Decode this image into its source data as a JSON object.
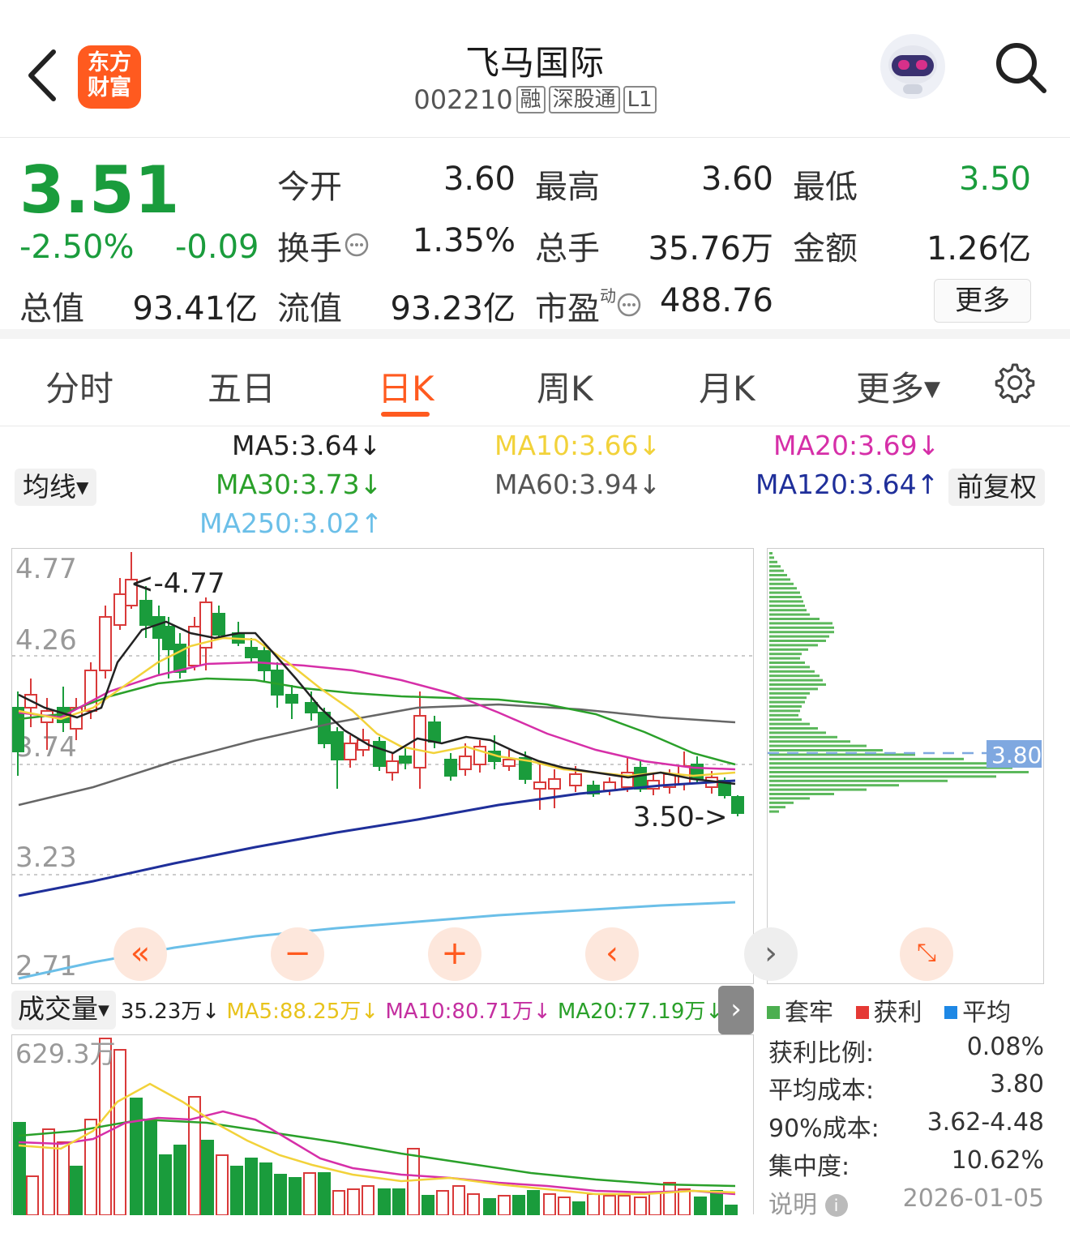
{
  "header": {
    "logo_text": "东方财富",
    "title": "飞马国际",
    "code": "002210",
    "tags": [
      "融",
      "深股通",
      "L1"
    ]
  },
  "quote": {
    "price": "3.51",
    "change_pct": "-2.50%",
    "change": "-0.09",
    "stats": [
      {
        "label": "今开",
        "value": "3.60"
      },
      {
        "label": "最高",
        "value": "3.60"
      },
      {
        "label": "最低",
        "value": "3.50"
      },
      {
        "label": "换手",
        "value": "1.35%"
      },
      {
        "label": "总手",
        "value": "35.76万"
      },
      {
        "label": "金额",
        "value": "1.26亿"
      },
      {
        "label": "总值",
        "value": "93.41亿"
      },
      {
        "label": "流值",
        "value": "93.23亿"
      },
      {
        "label": "市盈",
        "sup": "动",
        "value": "488.76"
      }
    ],
    "more_label": "更多",
    "down_color": "#1a9c3c",
    "up_color": "#d93a3a"
  },
  "tabs": {
    "items": [
      "分时",
      "五日",
      "日K",
      "周K",
      "月K",
      "更多"
    ],
    "active": "日K"
  },
  "ma_legend": {
    "mode_label": "均线",
    "adjust_label": "前复权",
    "items": [
      {
        "label": "MA5:3.64↓",
        "color": "#222222"
      },
      {
        "label": "MA10:3.66↓",
        "color": "#f2d23a"
      },
      {
        "label": "MA20:3.69↓",
        "color": "#d62fa8"
      },
      {
        "label": "MA30:3.73↓",
        "color": "#2aa02a"
      },
      {
        "label": "MA60:3.94↓",
        "color": "#555555"
      },
      {
        "label": "MA120:3.64↑",
        "color": "#1f2f9a"
      },
      {
        "label": "MA250:3.02↑",
        "color": "#6bbfe8"
      }
    ]
  },
  "kline": {
    "y_ticks": [
      "4.77",
      "4.26",
      "3.74",
      "3.23",
      "2.71"
    ],
    "high_marker": "<-4.77",
    "low_marker": "3.50->",
    "chip_cost_label": "3.80"
  },
  "volume": {
    "mode_label": "成交量",
    "current": "35.23万↓",
    "ma5": "MA5:88.25万↓",
    "ma10": "MA10:80.71万↓",
    "ma20": "MA20:77.19万↓",
    "max_tick": "629.3万"
  },
  "chips": {
    "legend": [
      {
        "label": "套牢",
        "color": "#4caf50"
      },
      {
        "label": "获利",
        "color": "#e53935"
      },
      {
        "label": "平均",
        "color": "#1e88e5"
      }
    ],
    "rows": [
      {
        "label": "获利比例:",
        "value": "0.08%"
      },
      {
        "label": "平均成本:",
        "value": "3.80"
      },
      {
        "label": "90%成本:",
        "value": "3.62-4.48"
      },
      {
        "label": "集中度:",
        "value": "10.62%"
      },
      {
        "label": "说明",
        "value": "2026-01-05"
      }
    ]
  }
}
